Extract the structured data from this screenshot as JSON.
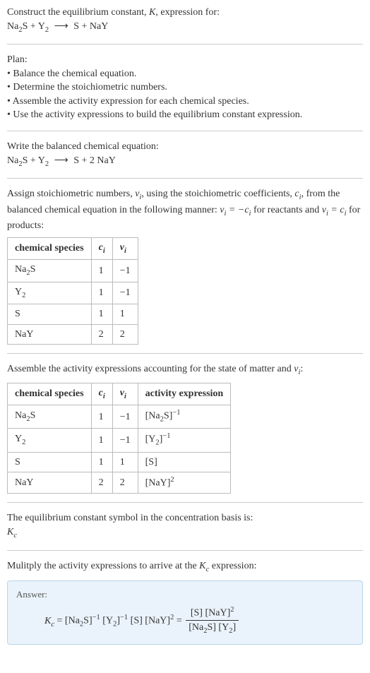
{
  "intro": {
    "line1_a": "Construct the equilibrium constant, ",
    "line1_b": ", expression for:",
    "K": "K",
    "eq_lhs_a": "Na",
    "eq_lhs_b": "S + Y",
    "eq_rhs": "S + NaY"
  },
  "plan": {
    "title": "Plan:",
    "b1": "Balance the chemical equation.",
    "b2": "Determine the stoichiometric numbers.",
    "b3": "Assemble the activity expression for each chemical species.",
    "b4": "Use the activity expressions to build the equilibrium constant expression."
  },
  "balanced": {
    "title": "Write the balanced chemical equation:",
    "lhs_a": "Na",
    "lhs_b": "S + Y",
    "rhs": "S + 2 NaY"
  },
  "stoich": {
    "text_a": "Assign stoichiometric numbers, ",
    "text_b": ", using the stoichiometric coefficients, ",
    "text_c": ", from the balanced chemical equation in the following manner: ",
    "text_d": " for reactants and ",
    "text_e": " for products:",
    "nu": "ν",
    "ci": "c",
    "rel_react_a": "ν",
    "rel_react_b": " = −c",
    "rel_prod_a": "ν",
    "rel_prod_b": " = c",
    "headers": {
      "h1": "chemical species",
      "h2": "c",
      "h3": "ν"
    },
    "rows": [
      {
        "sp_a": "Na",
        "sp_b": "S",
        "c": "1",
        "v": "−1"
      },
      {
        "sp_a": "Y",
        "sp_b": "",
        "c": "1",
        "v": "−1"
      },
      {
        "sp_a": "S",
        "sp_b": "",
        "c": "1",
        "v": "1"
      },
      {
        "sp_a": "NaY",
        "sp_b": "",
        "c": "2",
        "v": "2"
      }
    ]
  },
  "activity": {
    "title_a": "Assemble the activity expressions accounting for the state of matter and ",
    "title_b": ":",
    "headers": {
      "h1": "chemical species",
      "h2": "c",
      "h3": "ν",
      "h4": "activity expression"
    },
    "rows": [
      {
        "sp_a": "Na",
        "sp_b": "S",
        "c": "1",
        "v": "−1",
        "ae_a": "[Na",
        "ae_b": "S]",
        "ae_sup": "−1"
      },
      {
        "sp_a": "Y",
        "sp_b": "",
        "c": "1",
        "v": "−1",
        "ae_a": "[Y",
        "ae_b": "]",
        "ae_sup": "−1"
      },
      {
        "sp_a": "S",
        "sp_b": "",
        "c": "1",
        "v": "1",
        "ae_a": "[S]",
        "ae_b": "",
        "ae_sup": ""
      },
      {
        "sp_a": "NaY",
        "sp_b": "",
        "c": "2",
        "v": "2",
        "ae_a": "[NaY]",
        "ae_b": "",
        "ae_sup": "2"
      }
    ]
  },
  "basis": {
    "line": "The equilibrium constant symbol in the concentration basis is:",
    "K": "K",
    "sub": "c"
  },
  "final": {
    "line_a": "Mulitply the activity expressions to arrive at the ",
    "line_b": " expression:",
    "K": "K",
    "sub": "c",
    "answer_label": "Answer:",
    "lhs_K": "K",
    "lhs_sub": "c",
    "t1_a": "[Na",
    "t1_b": "S]",
    "t1_sup": "−1",
    "t2_a": "[Y",
    "t2_b": "]",
    "t2_sup": "−1",
    "t3": "[S]",
    "t4": "[NaY]",
    "t4_sup": "2",
    "num_a": "[S] [NaY]",
    "num_sup": "2",
    "den_a": "[Na",
    "den_b": "S] [Y",
    "den_c": "]"
  },
  "glyph": {
    "arrow": "⟶",
    "bullet": "•",
    "two": "2",
    "i": "i"
  }
}
